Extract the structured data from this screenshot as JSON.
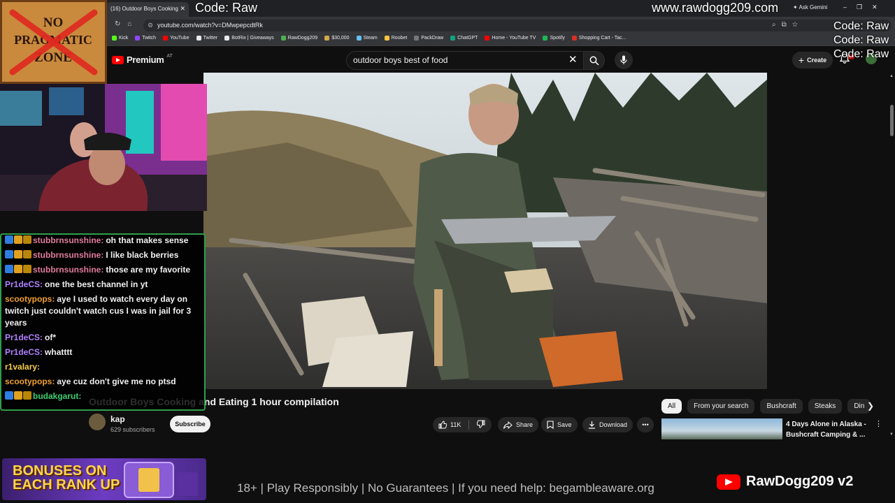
{
  "browser": {
    "tab_title": "(16) Outdoor Boys Cooking",
    "tab_close": "✕",
    "ask_gemini": "Ask Gemini",
    "url": "youtube.com/watch?v=DMwpepcdtRk",
    "bookmarks": [
      {
        "label": "Kick",
        "color": "#53fc18"
      },
      {
        "label": "Twitch",
        "color": "#9146ff"
      },
      {
        "label": "YouTube",
        "color": "#ff0000"
      },
      {
        "label": "Twitter",
        "color": "#e8eaed"
      },
      {
        "label": "BotRix | Giveaways",
        "color": "#e8eaed"
      },
      {
        "label": "RawDogg209",
        "color": "#4caf50"
      },
      {
        "label": "$30,000",
        "color": "#d4a94a"
      },
      {
        "label": "Steam",
        "color": "#66c0f4"
      },
      {
        "label": "Roobet",
        "color": "#f4c542"
      },
      {
        "label": "PackDraw",
        "color": "#777777"
      },
      {
        "label": "ChatGPT",
        "color": "#10a37f"
      },
      {
        "label": "Home - YouTube TV",
        "color": "#ff0000"
      },
      {
        "label": "Spotify",
        "color": "#1db954"
      },
      {
        "label": "Shopping Cart - Tac...",
        "color": "#d93025"
      }
    ]
  },
  "youtube": {
    "logo_text": "Premium",
    "logo_region": "AT",
    "search_value": "outdoor boys best of food",
    "create_label": "Create",
    "video_title": "Outdoor Boys Cooking and Eating 1 hour compilation",
    "channel_name": "kap",
    "channel_subs": "629 subscribers",
    "subscribe_label": "Subscribe",
    "likes": "11K",
    "share_label": "Share",
    "save_label": "Save",
    "download_label": "Download",
    "chips": [
      "All",
      "From your search",
      "Bushcraft",
      "Steaks",
      "Din"
    ],
    "rec_title": "4 Days Alone in Alaska - Bushcraft Camping & ..."
  },
  "overlay": {
    "code_label": "Code: Raw",
    "site": "www.rawdogg209.com",
    "code_stack": [
      "Code: Raw",
      "Code: Raw",
      "Code: Raw"
    ],
    "no_zone": [
      "NO",
      "PRAGMATIC",
      "ZONE"
    ],
    "bonus_lines": [
      "BONUSES ON",
      "EACH RANK UP"
    ],
    "disclaimer": "18+ | Play Responsibly | No Guarantees | If you need help: begambleaware.org",
    "brand": "RawDogg209 v2"
  },
  "chat": [
    {
      "user": "stubbrnsunshine:",
      "text": "oh that makes sense",
      "color": "#e07a9e",
      "badges": true
    },
    {
      "user": "stubbrnsunshine:",
      "text": "I like black berries",
      "color": "#e07a9e",
      "badges": true
    },
    {
      "user": "stubbrnsunshine:",
      "text": "those are my favorite",
      "color": "#e07a9e",
      "badges": true
    },
    {
      "user": "Pr1deCS:",
      "text": "one the best channel in yt",
      "color": "#b080ff",
      "badges": false
    },
    {
      "user": "scootypops:",
      "text": "aye I used to watch every day on twitch just couldn't watch cus I was in jail for 3 years",
      "color": "#f0a030",
      "badges": false
    },
    {
      "user": "Pr1deCS:",
      "text": "of*",
      "color": "#b080ff",
      "badges": false
    },
    {
      "user": "Pr1deCS:",
      "text": "whatttt",
      "color": "#b080ff",
      "badges": false
    },
    {
      "user": "r1valary:",
      "text": "",
      "color": "#f5d04a",
      "badges": false
    },
    {
      "user": "scootypops:",
      "text": "aye cuz don't give me no ptsd",
      "color": "#f0a030",
      "badges": false
    },
    {
      "user": "budakgarut:",
      "text": "",
      "color": "#3cd070",
      "badges": true
    }
  ]
}
